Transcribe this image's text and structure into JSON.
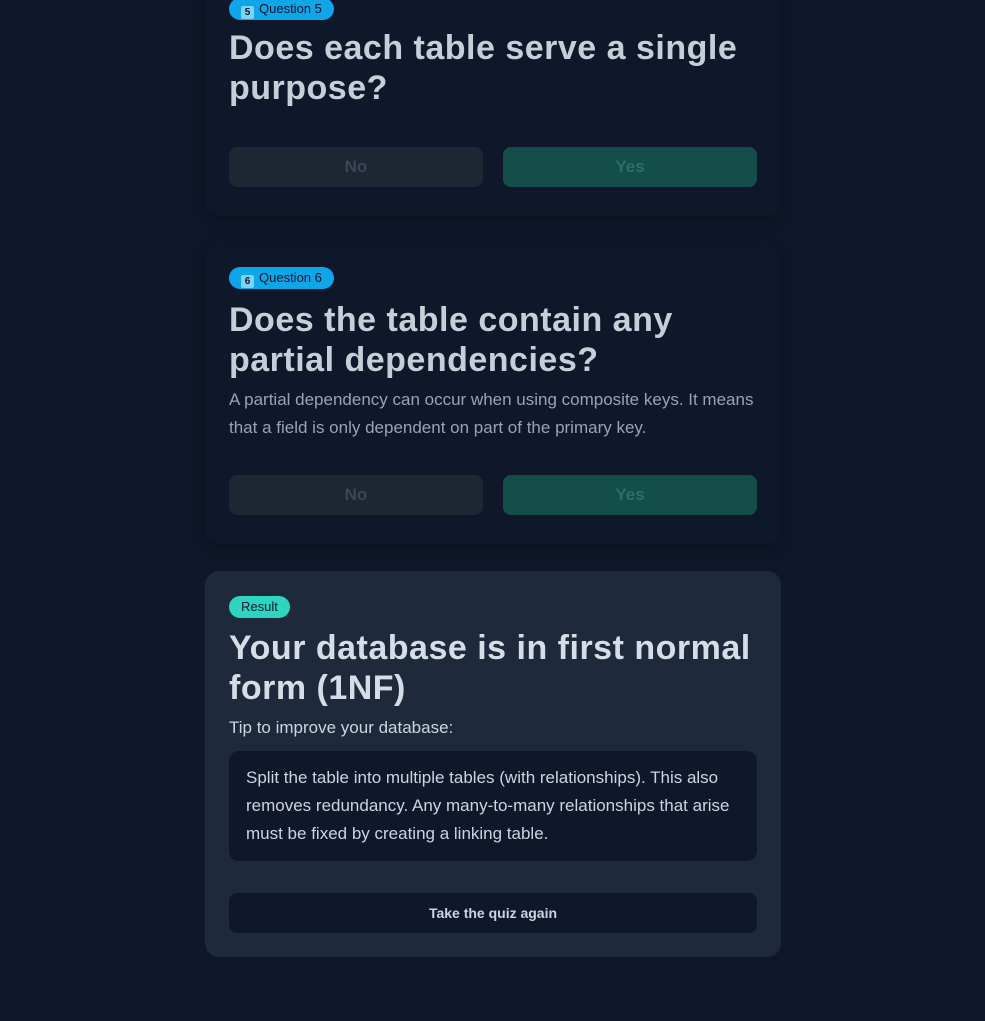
{
  "questions": [
    {
      "badge_icon": "5",
      "badge_label": "Question 5",
      "title": "Does each table serve a single purpose?",
      "description": "",
      "no_label": "No",
      "yes_label": "Yes"
    },
    {
      "badge_icon": "6",
      "badge_label": "Question 6",
      "title": "Does the table contain any partial dependencies?",
      "description": "A partial dependency can occur when using composite keys. It means that a field is only dependent on part of the primary key.",
      "no_label": "No",
      "yes_label": "Yes"
    }
  ],
  "result": {
    "badge_label": "Result",
    "title": "Your database is in first normal form (1NF)",
    "tip_label": "Tip to improve your database:",
    "tip_text": "Split the table into multiple tables (with relationships). This also removes redundancy. Any many-to-many relationships that arise must be fixed by creating a linking table.",
    "retry_label": "Take the quiz again"
  },
  "colors": {
    "background": "#0f172a",
    "question_badge": "#0ea5e9",
    "result_badge": "#2dd4bf",
    "yes_button": "#134e4a",
    "result_card": "#1e293b"
  }
}
